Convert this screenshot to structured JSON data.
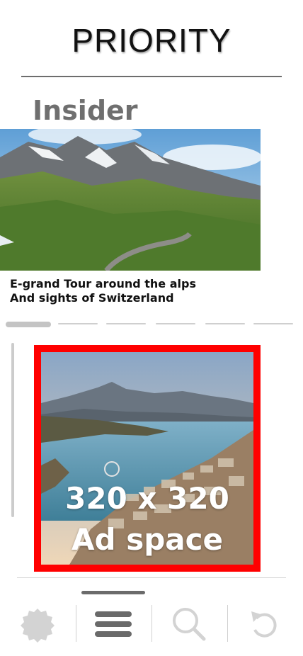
{
  "header": {
    "brand": "PRIORITY"
  },
  "section": {
    "title": "Insider"
  },
  "hero": {
    "caption_line1": "E-grand Tour around the alps",
    "caption_line2": "And sights of Switzerland"
  },
  "carousel": {
    "pages": 6,
    "active_index": 0
  },
  "ad": {
    "line1": "320 x 320",
    "line2": "Ad space",
    "border_color": "#ff0000"
  },
  "tabbar": {
    "items": [
      {
        "name": "badge-icon"
      },
      {
        "name": "menu-icon"
      },
      {
        "name": "search-icon"
      },
      {
        "name": "refresh-icon"
      }
    ]
  }
}
